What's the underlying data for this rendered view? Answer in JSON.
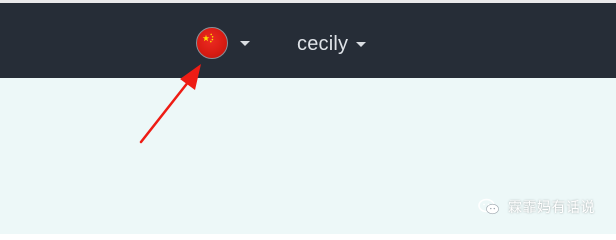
{
  "navbar": {
    "language": {
      "flag_icon": "china-flag-icon",
      "dropdown_icon": "caret-down-icon"
    },
    "user": {
      "name": "cecily",
      "dropdown_icon": "caret-down-icon"
    }
  },
  "annotation": {
    "arrow_icon": "red-arrow-icon",
    "color": "#ee1c14"
  },
  "watermark": {
    "icon": "wechat-icon",
    "text": "霖霏妈有话说"
  },
  "colors": {
    "navbar_bg": "#262d37",
    "page_bg": "#edf8f8",
    "flag_red": "#d91c13"
  }
}
